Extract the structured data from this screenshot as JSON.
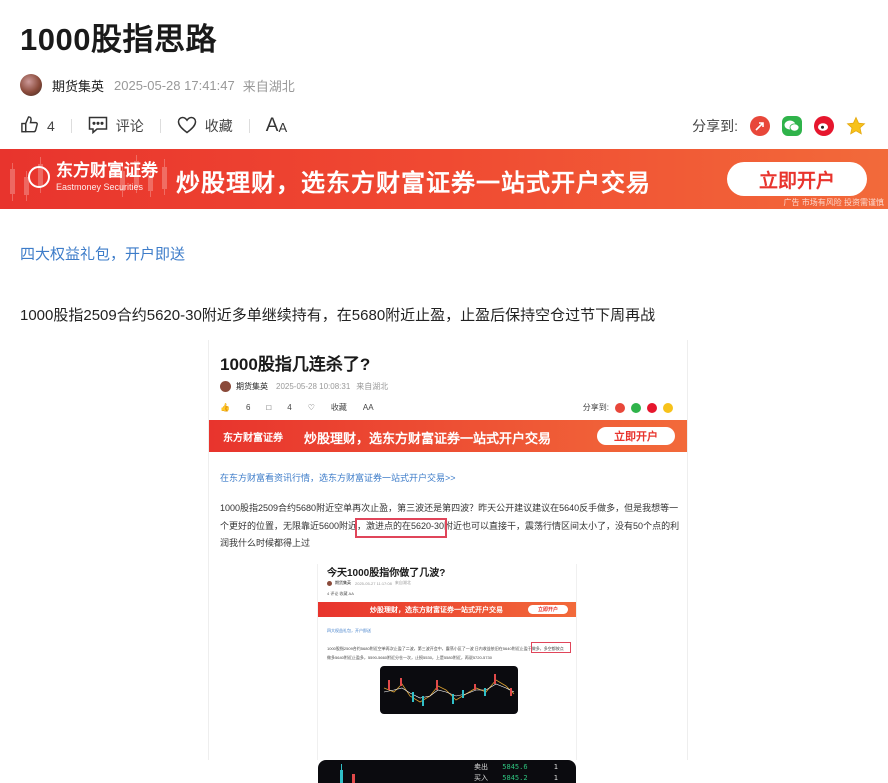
{
  "article": {
    "title": "1000股指思路",
    "author": "期货集英",
    "datetime": "2025-05-28 17:41:47",
    "location": "来自湖北"
  },
  "toolbar": {
    "like_count": "4",
    "comment_label": "评论",
    "favorite_label": "收藏",
    "font_label_big": "A",
    "font_label_small": "A",
    "share_label": "分享到:"
  },
  "banner": {
    "brand_cn": "东方财富证券",
    "brand_en": "Eastmoney Securities",
    "slogan": "炒股理财，选东方财富证券一站式开户交易",
    "button": "立即开户",
    "ad_note": "广告  市场有风险 投资需谨慎"
  },
  "promo_link": "四大权益礼包，开户即送",
  "paragraph": "1000股指2509合约5620-30附近多单继续持有，在5680附近止盈，止盈后保持空仓过节下周再战",
  "embedded1": {
    "title": "1000股指几连杀了?",
    "author": "期货集英",
    "datetime": "2025-05-28 10:08:31",
    "location": "来自湖北",
    "like_count": "6",
    "comment_count": "4",
    "favorite_label": "收藏",
    "font_label": "AA",
    "share_label": "分享到:",
    "brand_cn": "东方财富证券",
    "slogan": "炒股理财，选东方财富证券一站式开户交易",
    "button": "立即开户",
    "link": "在东方财富看资讯行情，选东方财富证券一站式开户交易>>",
    "paragraph": "1000股指2509合约5680附近空单再次止盈，第三波还是第四波？昨天公开建议建议在5640反手做多，但是我想等一个更好的位置，无限靠近5600附近，激进点的在5620-30附近也可以直接干，震荡行情区间太小了，没有50个点的利润我什么时候都得上过"
  },
  "embedded2": {
    "title": "今天1000股指你做了几波?",
    "author": "期货集英",
    "datetime": "2025-05-27 11:17:08",
    "location": "来自湖北",
    "toolbar": "4   评论   收藏   AA",
    "slogan": "炒股理财，选东方财富证券一站式开户交易",
    "button": "立即开户",
    "link": "四大权益礼包，开户即送",
    "paragraph": "1000股指2509合约5680附近空单再次止盈了二波，第三波开会中，震荡小区了一波 日内收益依旧在5640附近止盈于做多，多空都按点做多5640附近止盈多，5590-5660附近分仓一次，止损5530，上是5580附近，再说5720-5730"
  },
  "embedded3": {
    "quote1_label": "卖出",
    "quote1_price": "5845.6",
    "quote1_vol": "1",
    "quote2_label": "买入",
    "quote2_price": "5845.2",
    "quote2_vol": "1"
  },
  "colors": {
    "banner_red": "#e8342d",
    "link_blue": "#3d7cc9",
    "highlight_box": "#e0455a"
  }
}
